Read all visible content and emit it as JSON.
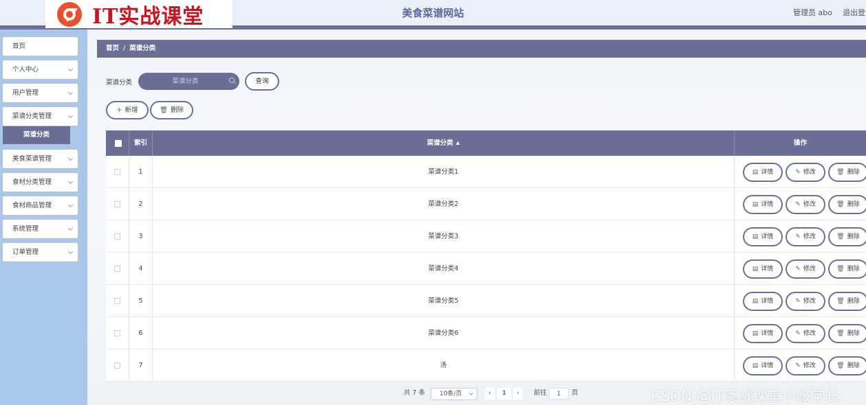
{
  "logo": {
    "text": "IT实战课堂"
  },
  "header": {
    "title": "美食菜谱网站",
    "user": "管理员 abo",
    "logout": "退出登录"
  },
  "sidebar": {
    "items": [
      {
        "label": "首页",
        "has_arrow": false
      },
      {
        "label": "个人中心",
        "has_arrow": true
      },
      {
        "label": "用户管理",
        "has_arrow": true
      },
      {
        "label": "菜谱分类管理",
        "has_arrow": true
      },
      {
        "label": "美食菜谱管理",
        "has_arrow": true
      },
      {
        "label": "食材分类管理",
        "has_arrow": true
      },
      {
        "label": "食材商品管理",
        "has_arrow": true
      },
      {
        "label": "系统管理",
        "has_arrow": true
      },
      {
        "label": "订单管理",
        "has_arrow": true
      }
    ],
    "active_sub": "菜谱分类"
  },
  "breadcrumb": {
    "home": "首页",
    "sep": "/",
    "current": "菜谱分类"
  },
  "search": {
    "label": "菜谱分类",
    "placeholder": "菜谱分类",
    "button": "查询"
  },
  "actions": {
    "add": "新增",
    "delete": "删除"
  },
  "table": {
    "headers": {
      "index": "索引",
      "category": "菜谱分类",
      "ops": "操作"
    },
    "rows": [
      {
        "index": "1",
        "category": "菜谱分类1"
      },
      {
        "index": "2",
        "category": "菜谱分类2"
      },
      {
        "index": "3",
        "category": "菜谱分类3"
      },
      {
        "index": "4",
        "category": "菜谱分类4"
      },
      {
        "index": "5",
        "category": "菜谱分类5"
      },
      {
        "index": "6",
        "category": "菜谱分类6"
      },
      {
        "index": "7",
        "category": "汤"
      }
    ],
    "row_buttons": {
      "detail": "详情",
      "edit": "修改",
      "delete": "删除"
    }
  },
  "pagination": {
    "total": "共 7 条",
    "page_size": "10条/页",
    "current_page": "1",
    "goto_label": "前往",
    "goto_value": "1",
    "page_suffix": "页"
  },
  "watermark": "CSDN @IT实战课堂小啵学长",
  "colors": {
    "primary": "#6b6f96",
    "sidebar": "#aac6e8",
    "logo_red": "#c8141e"
  }
}
